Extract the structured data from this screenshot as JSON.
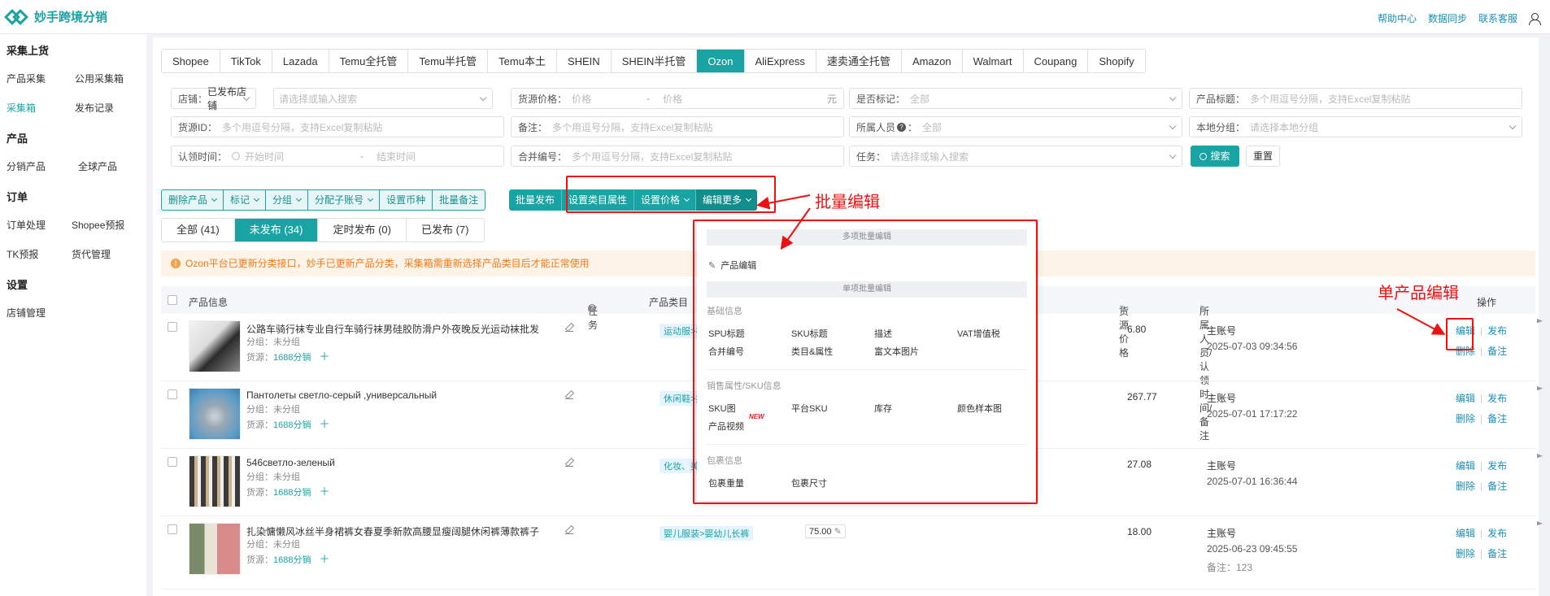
{
  "app": {
    "title": "妙手跨境分销"
  },
  "top_links": [
    "帮助中心",
    "数据同步",
    "联系客服"
  ],
  "sidebar": {
    "groups": [
      {
        "title": "采集上货",
        "items": [
          "产品采集",
          "公用采集箱",
          "采集箱",
          "发布记录"
        ]
      },
      {
        "title": "产品",
        "items": [
          "分销产品",
          "全球产品"
        ]
      },
      {
        "title": "订单",
        "items": [
          "订单处理",
          "Shopee预报",
          "TK预报",
          "货代管理"
        ]
      },
      {
        "title": "设置",
        "items": [
          "店铺管理"
        ]
      }
    ],
    "active_item": "采集箱"
  },
  "platform_tabs": [
    "Shopee",
    "TikTok",
    "Lazada",
    "Temu全托管",
    "Temu半托管",
    "Temu本土",
    "SHEIN",
    "SHEIN半托管",
    "Ozon",
    "AliExpress",
    "速卖通全托管",
    "Amazon",
    "Walmart",
    "Coupang",
    "Shopify"
  ],
  "active_platform": "Ozon",
  "filters": {
    "store_label": "店铺：",
    "store_value": "已发布店铺",
    "store_search_ph": "请选择或输入搜索",
    "price_label": "货源价格：",
    "price_min_ph": "价格",
    "price_dash": "-",
    "price_max_ph": "价格",
    "price_unit": "元",
    "marked_label": "是否标记：",
    "marked_value": "全部",
    "title_label": "产品标题：",
    "title_ph": "多个用逗号分隔，支持Excel复制粘贴",
    "source_id_label": "货源ID：",
    "source_id_ph": "多个用逗号分隔，支持Excel复制粘贴",
    "remark_label": "备注：",
    "remark_ph": "多个用逗号分隔，支持Excel复制粘贴",
    "owner_label": "所属人员",
    "owner_value": "全部",
    "local_group_label": "本地分组：",
    "local_group_ph": "请选择本地分组",
    "claim_time_label": "认领时间：",
    "start_ph": "开始时间",
    "end_ph": "结束时间",
    "merge_no_label": "合并编号：",
    "merge_no_ph": "多个用逗号分隔，支持Excel复制粘贴",
    "task_label": "任务：",
    "task_ph": "请选择或输入搜索",
    "search_btn": "搜索",
    "reset_btn": "重置"
  },
  "actions_light": [
    "删除产品",
    "标记",
    "分组",
    "分配子账号",
    "设置币种",
    "批量备注"
  ],
  "actions_dark": [
    "批量发布",
    "设置类目属性",
    "设置价格",
    "编辑更多"
  ],
  "status_tabs": [
    "全部 (41)",
    "未发布 (34)",
    "定时发布 (0)",
    "已发布 (7)"
  ],
  "active_status": "未发布 (34)",
  "notice": "Ozon平台已更新分类接口，妙手已更新产品分类，采集箱需重新选择产品类目后才能正常使用",
  "table_headers": {
    "info": "产品信息",
    "task": "任务",
    "category": "产品类目",
    "price": "货源价格",
    "owner": "所属人员/认领时间/备注",
    "ops": "操作"
  },
  "rows": [
    {
      "title": "公路车骑行袜专业自行车骑行袜男硅胶防滑户外夜晚反光运动袜批发",
      "group": "分组：未分组",
      "src_label": "货源：",
      "src": "1688分销",
      "category": "运动服>袜",
      "price": "6.80",
      "owner": "主账号",
      "time": "2025-07-03 09:34:56",
      "note": ""
    },
    {
      "title": "Пантолеты светло-серый ,универсальный",
      "group": "分组：未分组",
      "src_label": "货源：",
      "src": "1688分销",
      "category": "休闲鞋>拖",
      "price": "267.77",
      "owner": "主账号",
      "time": "2025-07-01 17:17:22",
      "note": ""
    },
    {
      "title": "546светло-зеленый",
      "group": "分组：未分组",
      "src_label": "货源：",
      "src": "1688分销",
      "category": "化妆、美容",
      "price": "27.08",
      "owner": "主账号",
      "time": "2025-07-01 16:36:44",
      "note": ""
    },
    {
      "title": "扎染慵懒风冰丝半身裙裤女春夏季新款高腰显瘦阔腿休闲裤薄款裤子",
      "group": "分组：未分组",
      "src_label": "货源：",
      "src": "1688分销",
      "category": "婴儿服装>婴幼儿长裤",
      "cat_price": "75.00",
      "price": "18.00",
      "owner": "主账号",
      "time": "2025-06-23 09:45:55",
      "note": "备注：123"
    }
  ],
  "row_ops": {
    "edit": "编辑",
    "publish": "发布",
    "delete": "删除",
    "remark": "备注"
  },
  "popup": {
    "multi_head": "多项批量编辑",
    "product_edit": "产品编辑",
    "single_head": "单项批量编辑",
    "basic_title": "基础信息",
    "basic_items": [
      "SPU标题",
      "SKU标题",
      "描述",
      "VAT增值税",
      "合并编号",
      "类目&属性",
      "富文本图片"
    ],
    "sku_title": "销售属性/SKU信息",
    "sku_items": [
      "SKU图",
      "平台SKU",
      "库存",
      "颜色样本图",
      "产品视频"
    ],
    "new_tag": "NEW",
    "pkg_title": "包裹信息",
    "pkg_items": [
      "包裹重量",
      "包裹尺寸"
    ]
  },
  "annotations": {
    "batch_edit": "批量编辑",
    "single_edit": "单产品编辑"
  },
  "colors": {
    "accent": "#1aa3a3",
    "link": "#1a8fb8",
    "annotation": "#e11111",
    "notice": "#f07a1a"
  }
}
